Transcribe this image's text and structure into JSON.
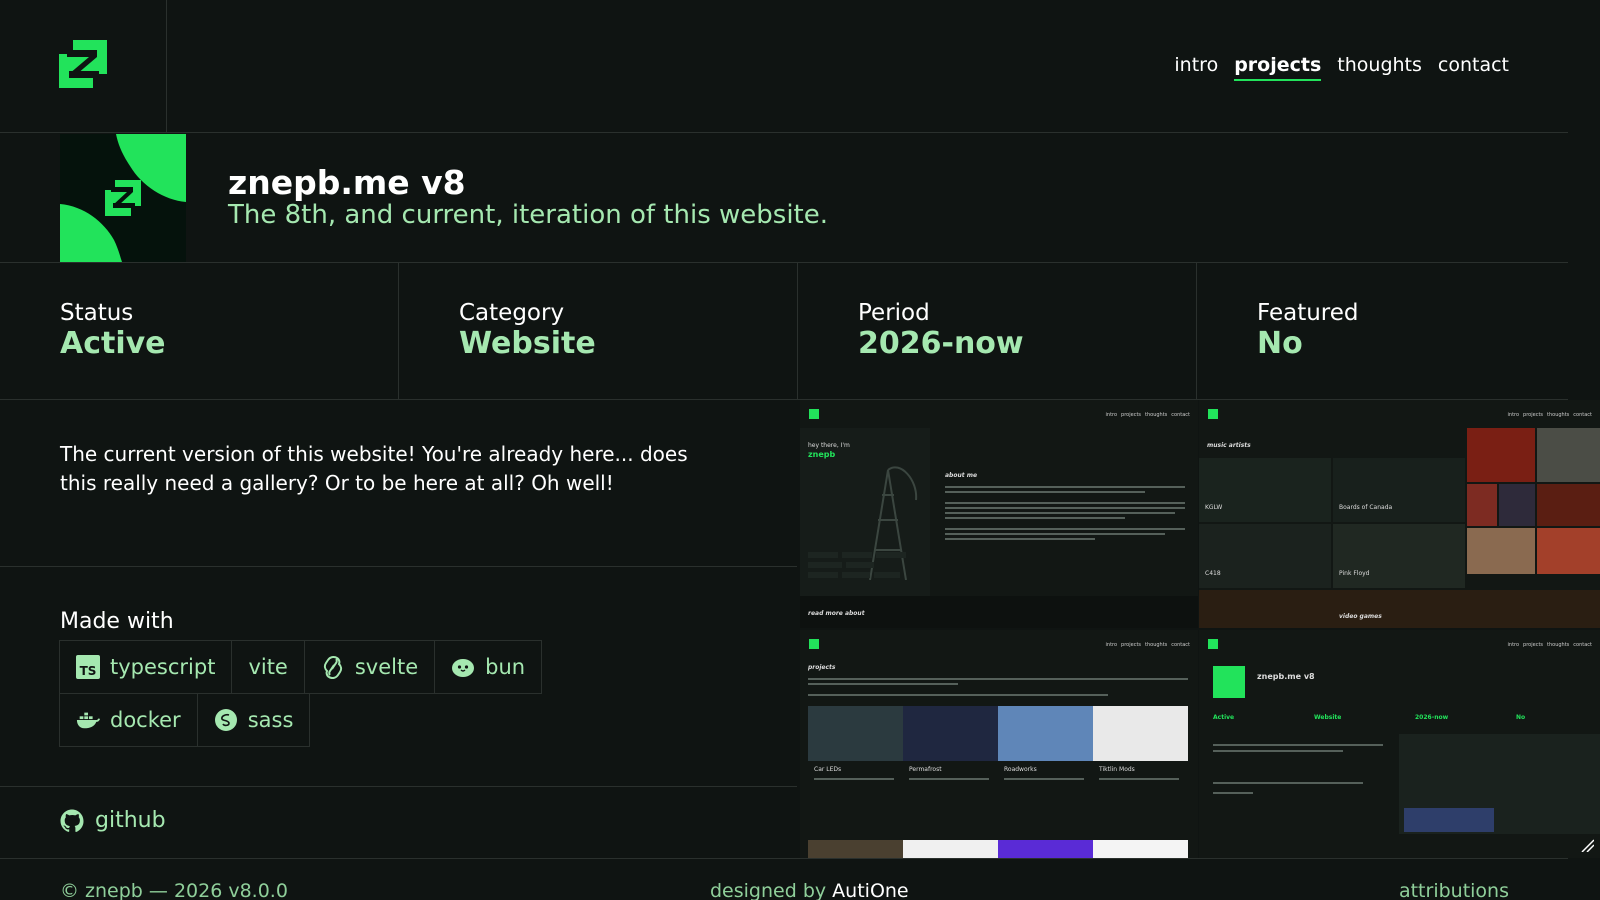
{
  "nav": {
    "items": [
      {
        "label": "intro",
        "active": false
      },
      {
        "label": "projects",
        "active": true
      },
      {
        "label": "thoughts",
        "active": false
      },
      {
        "label": "contact",
        "active": false
      }
    ]
  },
  "project": {
    "title": "znepb.me v8",
    "subtitle": "The 8th, and current, iteration of this website."
  },
  "stats": [
    {
      "label": "Status",
      "value": "Active"
    },
    {
      "label": "Category",
      "value": "Website"
    },
    {
      "label": "Period",
      "value": "2026-now"
    },
    {
      "label": "Featured",
      "value": "No"
    }
  ],
  "description": "The current version of this website! You're already here... does this really need a gallery? Or to be here at all? Oh well!",
  "made_with": {
    "label": "Made with",
    "tags": [
      "typescript",
      "vite",
      "svelte",
      "bun",
      "docker",
      "sass"
    ]
  },
  "links": {
    "github": "github"
  },
  "footer": {
    "copyright": "© znepb — 2026 v8.0.0",
    "designed_prefix": "designed by ",
    "designer": "AutiOne",
    "attributions": "attributions"
  },
  "gallery": {
    "shot1": {
      "greeting": "hey there, I'm",
      "name": "znepb",
      "heading": "about me",
      "read_more": "read more about"
    },
    "shot2": {
      "heading": "music artists",
      "artists": [
        "KGLW",
        "Boards of Canada",
        "C418",
        "Pink Floyd"
      ],
      "games": "video games"
    },
    "shot3": {
      "heading": "projects",
      "cards": [
        "Car LEDs",
        "Permafrost",
        "Roadworks",
        "Tiktlin Mods"
      ]
    },
    "shot4": {
      "title": "znepb.me v8",
      "status": "Active",
      "category": "Website",
      "period": "2026-now",
      "featured": "No"
    }
  },
  "colors": {
    "accent": "#22e35b",
    "accent_soft": "#a5e8b0",
    "background": "#0f1412",
    "border": "#2a302d"
  }
}
